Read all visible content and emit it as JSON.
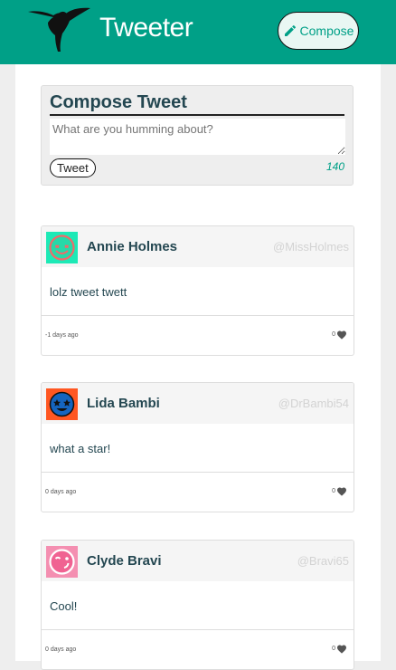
{
  "navbar": {
    "brand": "Tweeter",
    "logo_icon": "hummingbird-icon",
    "compose_label": "Compose",
    "compose_icon": "pencil-icon",
    "background": "#00a087"
  },
  "compose": {
    "title": "Compose Tweet",
    "placeholder": "What are you humming about?",
    "tweet_button": "Tweet",
    "counter": "140"
  },
  "tweets": [
    {
      "name": "Annie Holmes",
      "handle": "@MissHolmes",
      "text": "lolz tweet twett",
      "date": "-1 days ago",
      "likes": "0",
      "avatar_icon": "smiley-avatar-icon",
      "avatar_color": "#1de9b6"
    },
    {
      "name": "Lida Bambi",
      "handle": "@DrBambi54",
      "text": "what a star!",
      "date": "0 days ago",
      "likes": "0",
      "avatar_icon": "star-eyes-avatar-icon",
      "avatar_color": "#ff5722"
    },
    {
      "name": "Clyde Bravi",
      "handle": "@Bravi65",
      "text": "Cool!",
      "date": "0 days ago",
      "likes": "0",
      "avatar_icon": "wink-avatar-icon",
      "avatar_color": "#f48fb1"
    }
  ]
}
